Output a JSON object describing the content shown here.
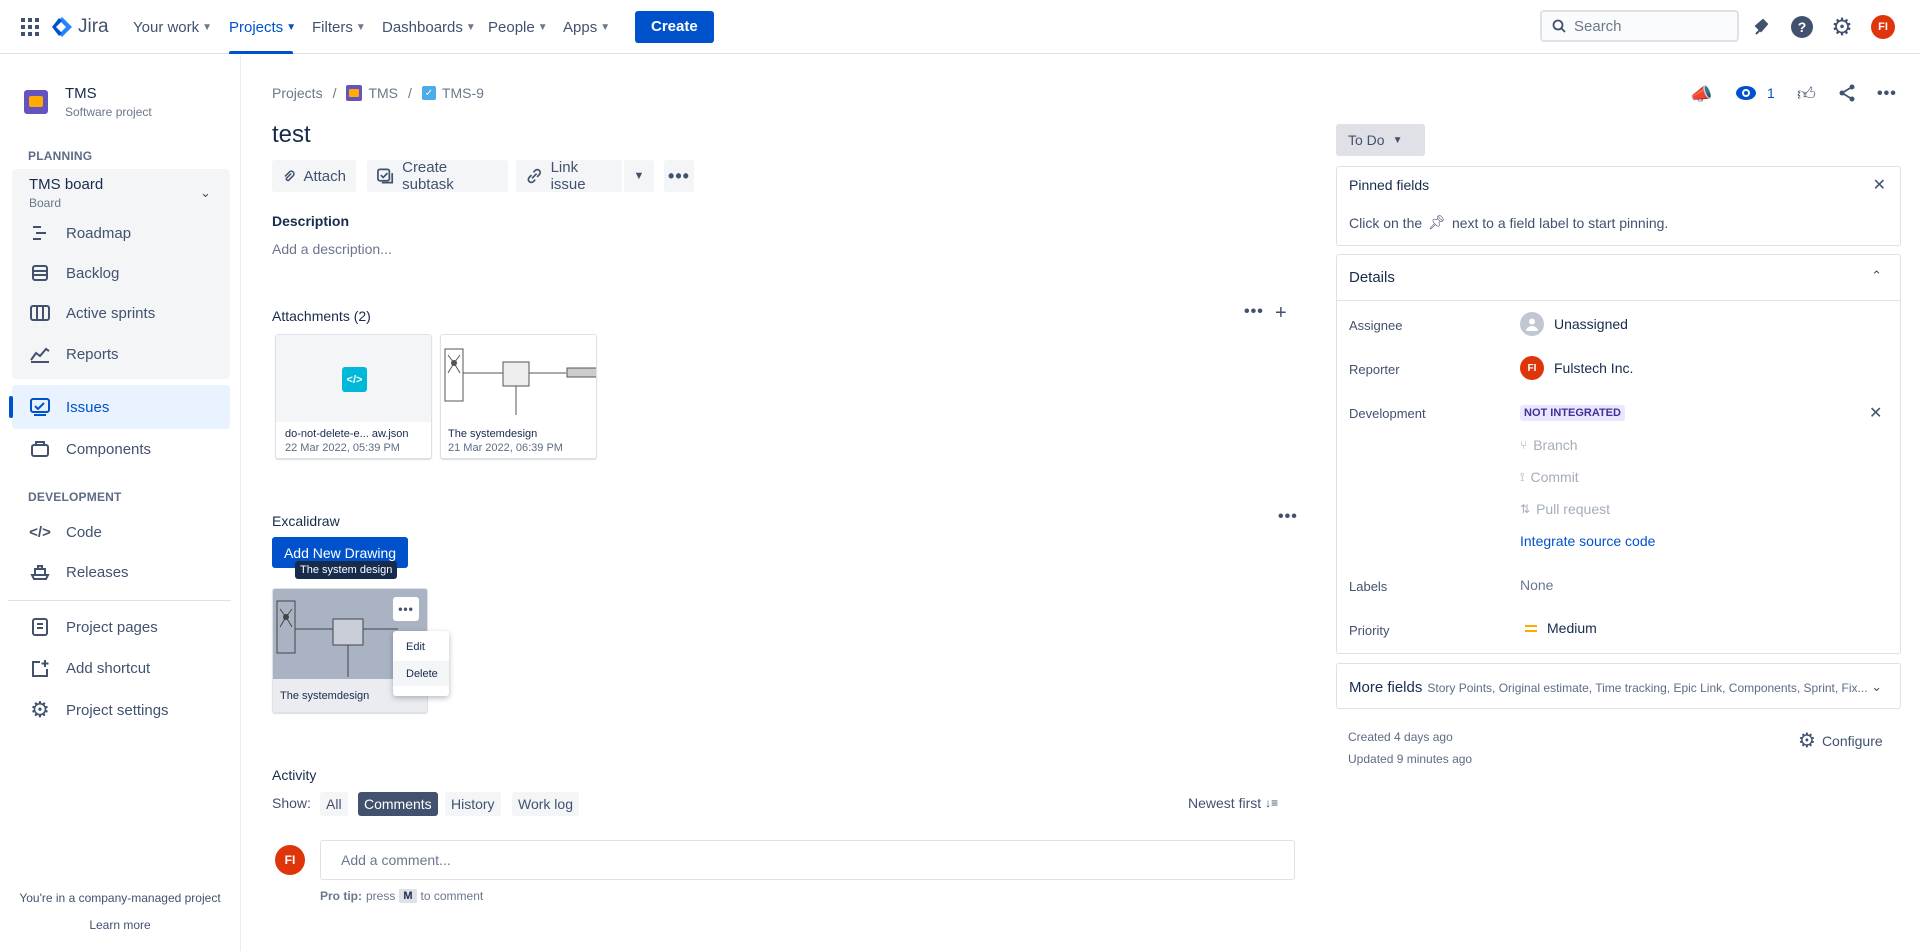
{
  "topnav": {
    "product": "Jira",
    "items": [
      {
        "label": "Your work"
      },
      {
        "label": "Projects",
        "active": true
      },
      {
        "label": "Filters"
      },
      {
        "label": "Dashboards"
      },
      {
        "label": "People"
      },
      {
        "label": "Apps"
      }
    ],
    "create": "Create",
    "search_placeholder": "Search",
    "avatar_initials": "FI"
  },
  "sidebar": {
    "project_name": "TMS",
    "project_type": "Software project",
    "planning": "PLANNING",
    "board_name": "TMS board",
    "board_sub": "Board",
    "items": [
      "Roadmap",
      "Backlog",
      "Active sprints",
      "Reports",
      "Issues",
      "Components"
    ],
    "development": "DEVELOPMENT",
    "dev_items": [
      "Code",
      "Releases"
    ],
    "bottom_items": [
      "Project pages",
      "Add shortcut",
      "Project settings"
    ],
    "footer_text": "You're in a company-managed project",
    "learn_more": "Learn more"
  },
  "breadcrumb": {
    "projects": "Projects",
    "project": "TMS",
    "issue": "TMS-9"
  },
  "issue": {
    "title": "test",
    "actions": {
      "attach": "Attach",
      "create_subtask": "Create subtask",
      "link_issue": "Link issue"
    },
    "description_label": "Description",
    "description_placeholder": "Add a description...",
    "attachments_label": "Attachments (2)",
    "attachments": [
      {
        "name": "do-not-delete-e... aw.json",
        "date": "22 Mar 2022, 05:39 PM"
      },
      {
        "name": "The systemdesign",
        "date": "21 Mar 2022, 06:39 PM"
      }
    ],
    "excalidraw_label": "Excalidraw",
    "add_drawing": "Add New Drawing",
    "tooltip": "The system design",
    "drawing_name": "The systemdesign",
    "menu": [
      "Edit",
      "Delete"
    ],
    "activity_label": "Activity",
    "show_label": "Show:",
    "tabs": [
      "All",
      "Comments",
      "History",
      "Work log"
    ],
    "newest_first": "Newest first",
    "comment_placeholder": "Add a comment...",
    "pro_tip": "Pro tip:",
    "pro_tip_press": "press",
    "pro_tip_key": "M",
    "pro_tip_rest": "to comment"
  },
  "right": {
    "watch_count": "1",
    "status": "To Do",
    "pinned_title": "Pinned fields",
    "pinned_hint_a": "Click on the",
    "pinned_hint_b": "next to a field label to start pinning.",
    "details": "Details",
    "fields": {
      "assignee_label": "Assignee",
      "assignee": "Unassigned",
      "reporter_label": "Reporter",
      "reporter": "Fulstech Inc.",
      "development_label": "Development",
      "dev_badge": "NOT INTEGRATED",
      "branch": "Branch",
      "commit": "Commit",
      "pull_request": "Pull request",
      "integrate": "Integrate source code",
      "labels_label": "Labels",
      "labels": "None",
      "priority_label": "Priority",
      "priority": "Medium"
    },
    "more_fields": "More fields",
    "more_fields_list": "Story Points, Original estimate, Time tracking, Epic Link, Components, Sprint, Fix...",
    "created": "Created 4 days ago",
    "updated": "Updated 9 minutes ago",
    "configure": "Configure"
  },
  "colors": {
    "primary": "#0052cc",
    "avatar": "#de350b",
    "priority": "#ffab00"
  }
}
